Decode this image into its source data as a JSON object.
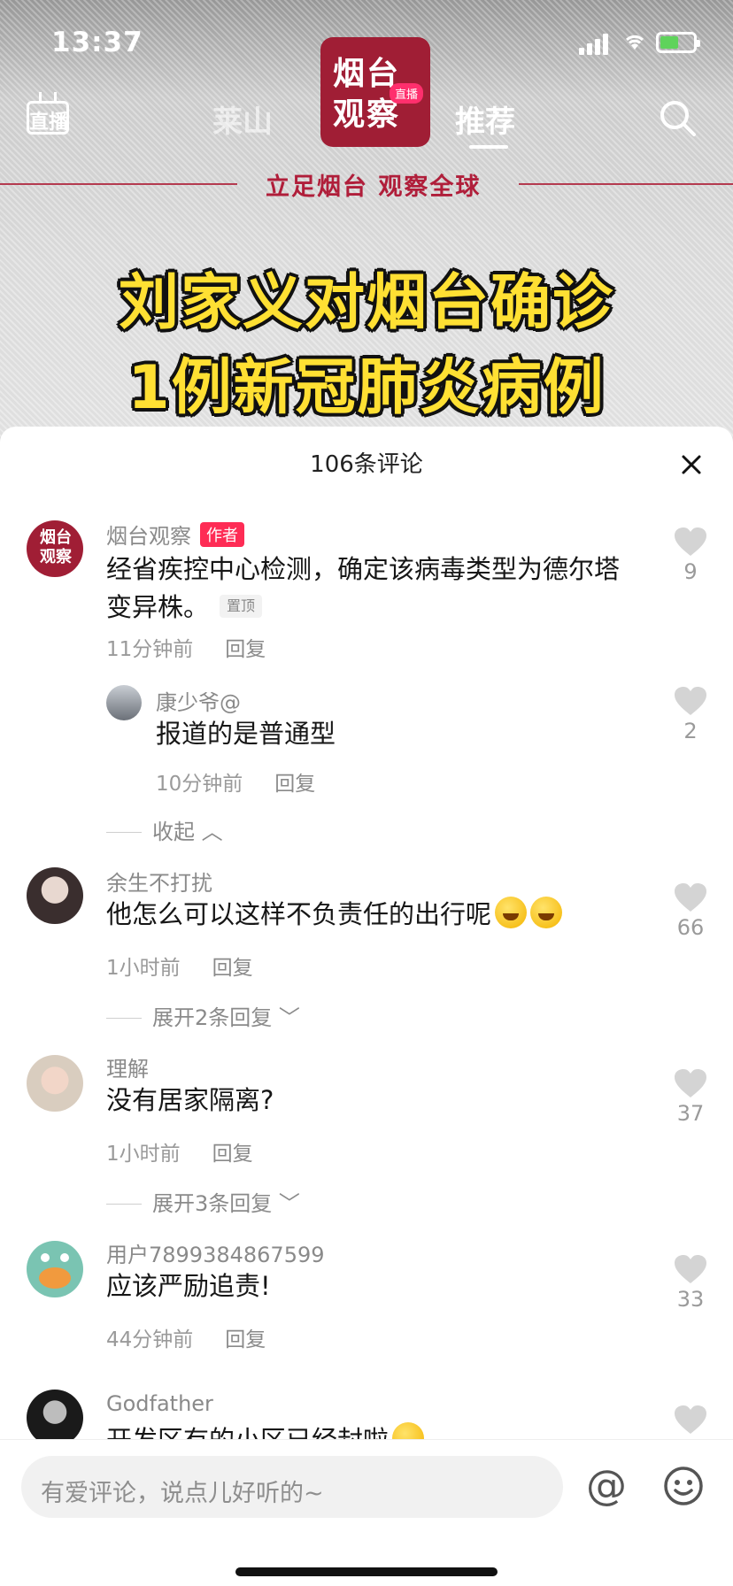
{
  "status_bar": {
    "time": "13:37"
  },
  "top_nav": {
    "live_label": "直播",
    "tab_left": "莱山",
    "tab_active": "推荐",
    "logo_line1": "烟台",
    "logo_line2": "观察",
    "logo_live_tag": "直播"
  },
  "video": {
    "slogan": "立足烟台 观察全球",
    "headline_line1": "刘家义对烟台确诊",
    "headline_line2": "1例新冠肺炎病例"
  },
  "panel": {
    "title": "106条评论"
  },
  "comments": [
    {
      "user": "烟台观察",
      "author_tag": "作者",
      "text_line1": "经省疾控中心检测，确定该病毒类型为德尔塔",
      "text_line2": "变异株。",
      "pin_tag": "置顶",
      "time": "11分钟前",
      "reply": "回复",
      "likes": "9",
      "avatar_text": "烟台观察"
    },
    {
      "user": "康少爷@",
      "text": "报道的是普通型",
      "time": "10分钟前",
      "reply": "回复",
      "likes": "2",
      "collapse": "收起"
    },
    {
      "user": "余生不打扰",
      "text": "他怎么可以这样不负责任的出行呢",
      "time": "1小时前",
      "reply": "回复",
      "likes": "66",
      "expand": "展开2条回复"
    },
    {
      "user": "理解",
      "text": "没有居家隔离?",
      "time": "1小时前",
      "reply": "回复",
      "likes": "37",
      "expand": "展开3条回复"
    },
    {
      "user": "用户7899384867599",
      "text": "应该严励追责!",
      "time": "44分钟前",
      "reply": "回复",
      "likes": "33"
    },
    {
      "user": "Godfather",
      "text": "开发区有的小区已经封啦"
    }
  ],
  "input_bar": {
    "placeholder": "有爱评论，说点儿好听的~",
    "at": "@"
  }
}
